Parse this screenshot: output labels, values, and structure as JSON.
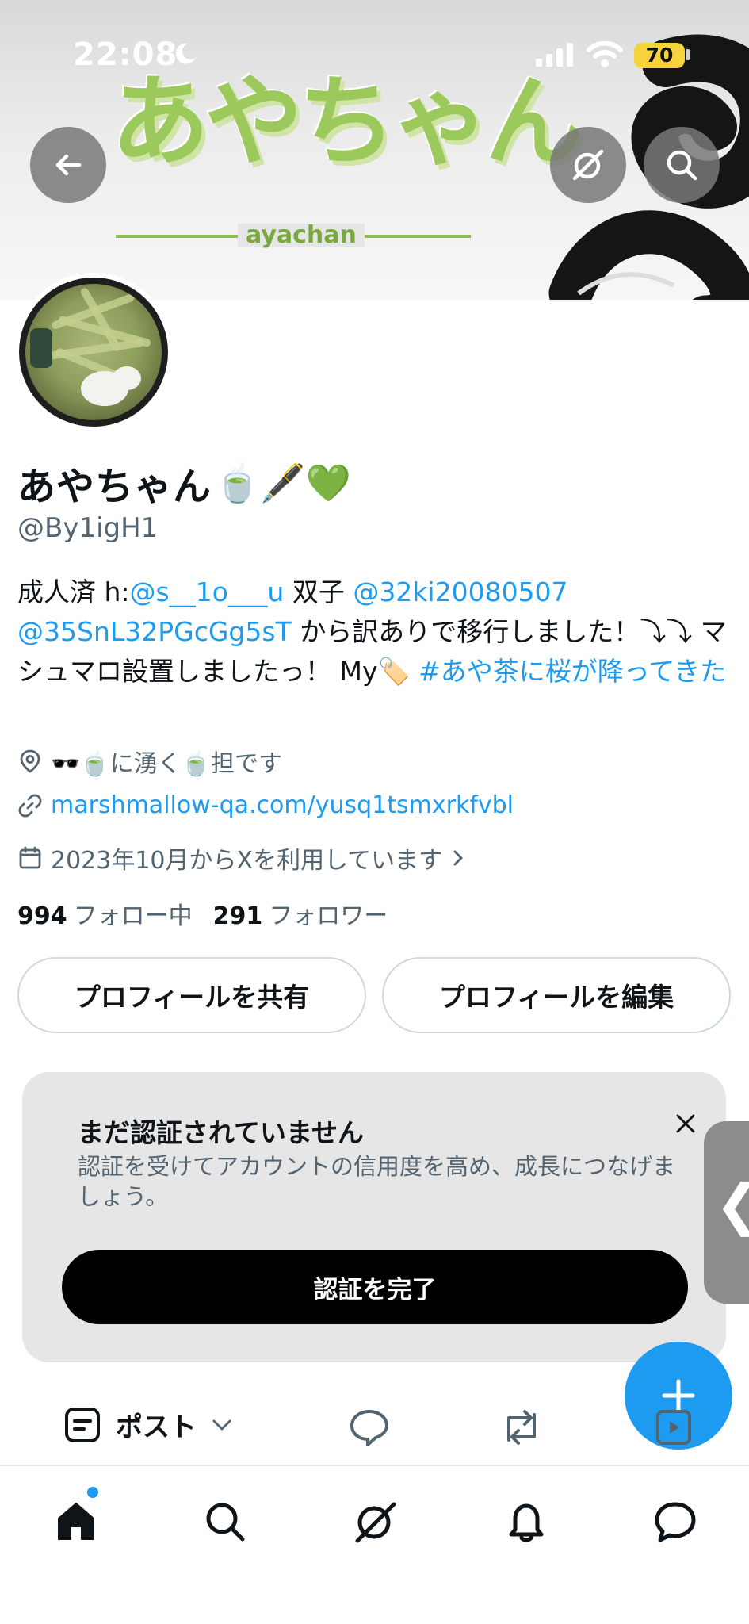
{
  "status_bar": {
    "time": "22:08",
    "battery": "70"
  },
  "banner": {
    "logo_text": "あやちゃん",
    "logo_sub": "ayachan"
  },
  "profile": {
    "display_name": "あやちゃん",
    "name_emojis": "🍵🖋️💚",
    "handle": "@By1igH1",
    "bio": {
      "prefix": "成人済 h:",
      "mention1": "@s__1o___u",
      "text1": " 双子 ",
      "mention2": "@32ki20080507",
      "mention3": "@35SnL32PGcGg5sT",
      "text2": " から訳ありで移行しました！⤵︎⤵︎ マシュマロ設置しましたっ！ My🏷️ ",
      "hashtag": "#あや茶に桜が降ってきた"
    },
    "location": "🕶️🍵に湧く🍵担です",
    "link": "marshmallow-qa.com/yusq1tsmxrkfvbl",
    "joined": "2023年10月からXを利用しています",
    "following_count": "994",
    "following_label": "フォロー中",
    "followers_count": "291",
    "followers_label": "フォロワー",
    "share_button": "プロフィールを共有",
    "edit_button": "プロフィールを編集"
  },
  "verification": {
    "title": "まだ認証されていません",
    "description": "認証を受けてアカウントの信用度を高め、成長につなげましょう。",
    "button": "認証を完了"
  },
  "tabs": {
    "posts_label": "ポスト"
  },
  "colors": {
    "accent": "#1d9bf0",
    "text": "#0f1419",
    "secondary": "#536471",
    "card_bg": "#e6e6e6"
  },
  "icons": {
    "back": "back-arrow-icon",
    "grok": "grok-icon",
    "search": "search-icon",
    "location": "location-pin-icon",
    "link": "link-icon",
    "calendar": "calendar-icon",
    "close": "close-icon",
    "compose": "plus-icon",
    "nav": [
      "home-icon",
      "search-icon",
      "grok-icon",
      "bell-icon",
      "messages-icon"
    ]
  }
}
